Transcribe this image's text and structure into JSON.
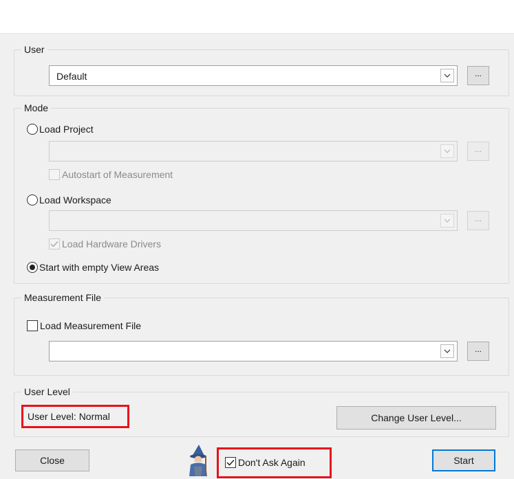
{
  "user_group": {
    "legend": "User",
    "selected_user": "Default",
    "browse_label": "..."
  },
  "mode_group": {
    "legend": "Mode",
    "load_project": {
      "label": "Load Project",
      "selected": false,
      "browse_label": "..."
    },
    "autostart": {
      "label": "Autostart of Measurement",
      "checked": false,
      "enabled": false
    },
    "load_workspace": {
      "label": "Load Workspace",
      "selected": false,
      "browse_label": "..."
    },
    "load_hw_drivers": {
      "label": "Load Hardware Drivers",
      "checked": true,
      "enabled": false
    },
    "start_empty": {
      "label": "Start with empty View Areas",
      "selected": true
    }
  },
  "measurement_group": {
    "legend": "Measurement File",
    "load_file": {
      "label": "Load Measurement File",
      "checked": false
    },
    "browse_label": "..."
  },
  "user_level_group": {
    "legend": "User Level",
    "status_text": "User Level: Normal",
    "change_button": "Change User Level..."
  },
  "footer": {
    "close_button": "Close",
    "dont_ask_again": {
      "label": "Don't Ask Again",
      "checked": true
    },
    "start_button": "Start",
    "wizard_icon": "wizard-icon"
  },
  "colors": {
    "highlight_red": "#e8101c",
    "default_button_border": "#0078d7",
    "dialog_background": "#f0f0f0"
  }
}
